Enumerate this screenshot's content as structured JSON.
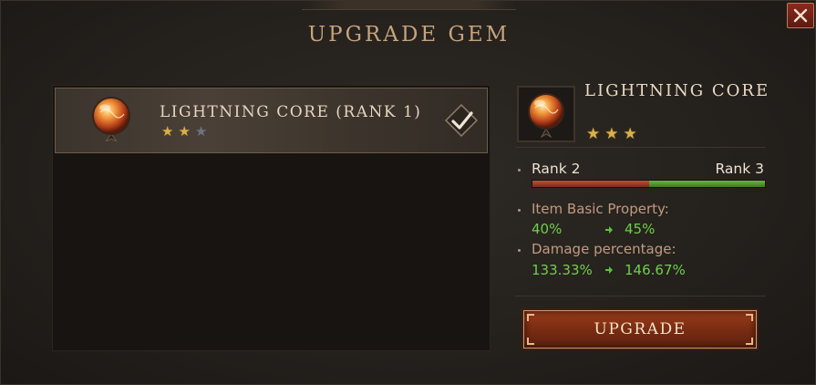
{
  "dialog": {
    "title": "Upgrade Gem",
    "close_icon": "close-icon"
  },
  "gem_list": {
    "items": [
      {
        "name": "Lightning Core (Rank 1)",
        "stars_total": 3,
        "stars_filled": 2,
        "selected": true,
        "icon": "gem-orb-icon",
        "check_icon": "checkmark-icon"
      }
    ]
  },
  "detail": {
    "name": "Lightning Core",
    "stars_total": 3,
    "stars_filled": 3,
    "rank_from": "Rank 2",
    "rank_to": "Rank 3",
    "rank_progress": 0.5,
    "properties": [
      {
        "label": "Item Basic Property:",
        "from": "40%",
        "to": "45%"
      },
      {
        "label": "Damage percentage:",
        "from": "133.33%",
        "to": "146.67%"
      }
    ],
    "upgrade_label": "Upgrade"
  },
  "colors": {
    "accent_gold": "#c6a37c",
    "value_green": "#6fcf4a",
    "label_rose": "#c19a80",
    "button_red": "#7a2c12"
  }
}
